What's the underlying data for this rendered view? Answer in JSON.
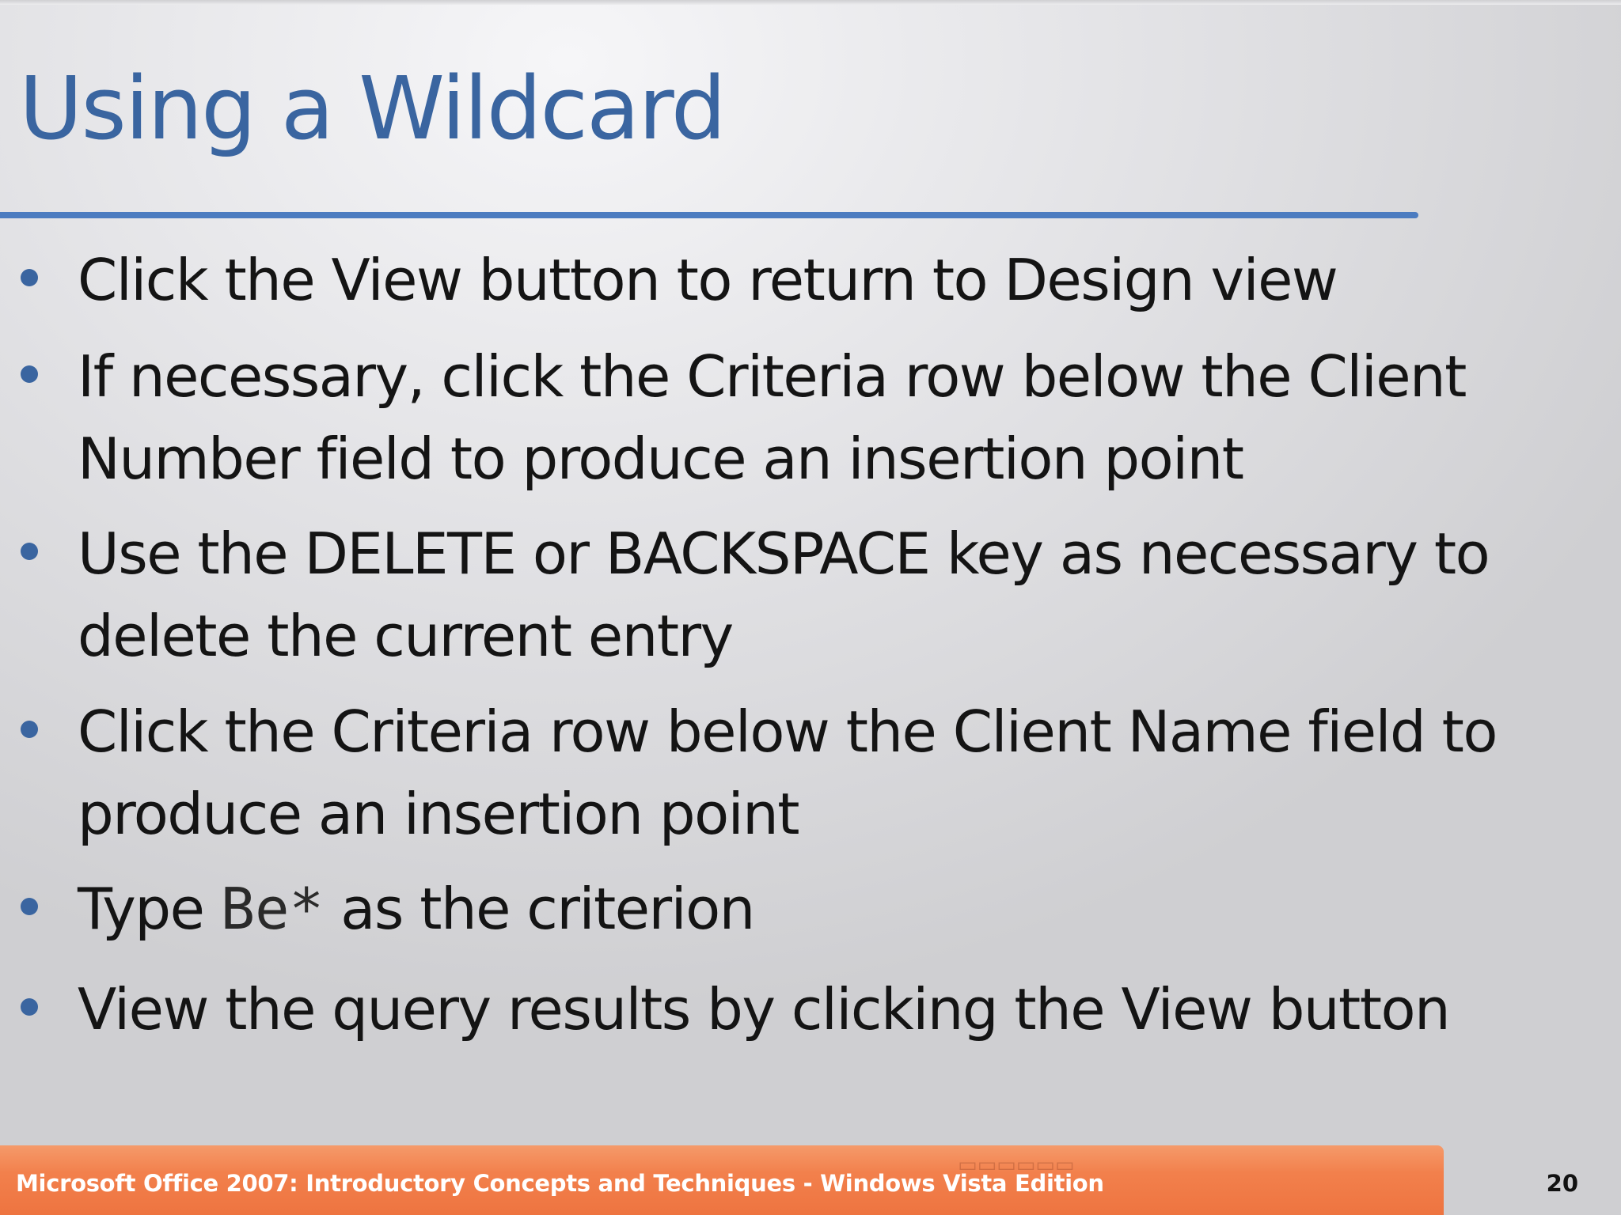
{
  "slide": {
    "title": "Using a Wildcard",
    "bullets": [
      {
        "lines": [
          "Click the View button to return to Design view"
        ]
      },
      {
        "lines": [
          "If necessary, click the Criteria row below the Client",
          "Number field to produce an insertion point"
        ]
      },
      {
        "lines": [
          "Use the DELETE or BACKSPACE key as necessary to",
          "delete the current entry"
        ]
      },
      {
        "lines": [
          "Click the Criteria row below the Client Name field to",
          "produce an insertion point"
        ]
      },
      {
        "prefix": "Type ",
        "code": "Be*",
        "suffix": " as the criterion"
      },
      {
        "lines": [
          "View the query results by clicking the View button"
        ]
      }
    ]
  },
  "footer": {
    "text": "Microsoft Office 2007: Introductory Concepts and Techniques - Windows Vista Edition",
    "page_number": "20"
  },
  "colors": {
    "title": "#3a65a0",
    "rule": "#4c7cc0",
    "footer_bar": "#f2804c"
  }
}
